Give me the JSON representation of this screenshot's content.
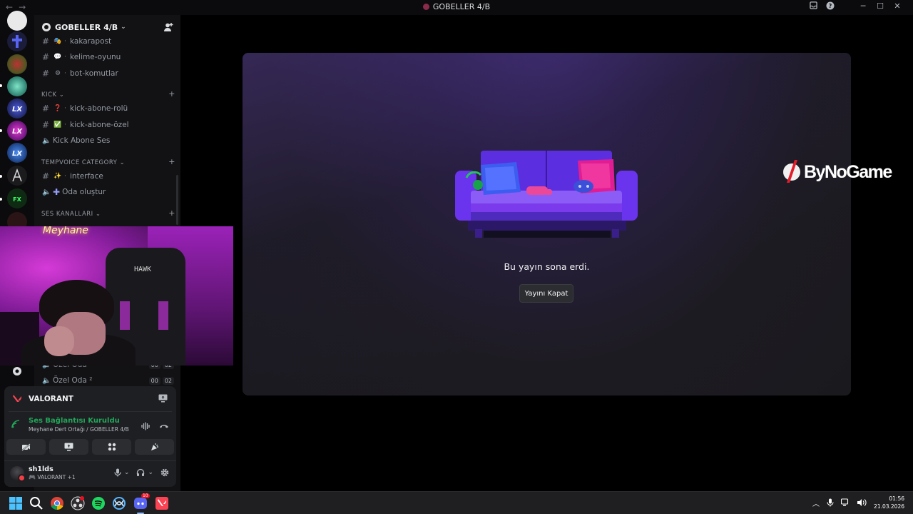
{
  "window": {
    "title": "GOBELLER 4/B",
    "nav_back": "←",
    "nav_forward": "→",
    "controls": {
      "minimize": "─",
      "maximize": "☐",
      "close": "✕"
    }
  },
  "guild": {
    "name": "GOBELLER 4/B",
    "chevron": "⌄"
  },
  "channels": {
    "top": [
      {
        "emoji": "🎭",
        "name": "kakarapost"
      },
      {
        "emoji": "💬",
        "name": "kelime-oyunu"
      },
      {
        "emoji": "⚙",
        "name": "bot-komutlar"
      }
    ],
    "kick_category": "KICK",
    "kick": [
      {
        "emoji": "❓",
        "name": "kick-abone-rolü"
      },
      {
        "emoji": "✅",
        "name": "kick-abone-özel"
      }
    ],
    "kick_voice": "Kick Abone Ses",
    "tempvoice_category": "TEMPVOICE CATEGORY",
    "tempvoice_text": {
      "emoji": "✨",
      "name": "interface"
    },
    "tempvoice_voice": "Oda oluştur",
    "voice_category": "SES KANALLARI",
    "partial_channel": "Özel Oda",
    "private_room": {
      "name": "Özel Oda ²",
      "count_a": "00",
      "count_b": "02"
    },
    "partial_counts": {
      "a": "00",
      "b": "02"
    }
  },
  "activity": {
    "game": "VALORANT"
  },
  "voice": {
    "status": "Ses Bağlantısı Kuruldu",
    "location": "Meyhane Dert Ortağı / GOBELLER 4/B"
  },
  "user": {
    "name": "sh1lds",
    "status": "VALORANT +1"
  },
  "stage": {
    "message": "Bu yayın sona erdi.",
    "close_button": "Yayını Kapat"
  },
  "overlay": {
    "brand": "ByNoGame",
    "chair_text": "HAWK",
    "neon_text": "Meyhane"
  },
  "taskbar": {
    "time": "01:56",
    "date": "21.03.2026",
    "discord_badge": "10",
    "tray_chevron": "︿"
  },
  "colors": {
    "accent_green": "#23a55a",
    "discord_blurple": "#5865f2",
    "valorant_red": "#fa4454",
    "stage_purple": "#3b2a6b"
  }
}
